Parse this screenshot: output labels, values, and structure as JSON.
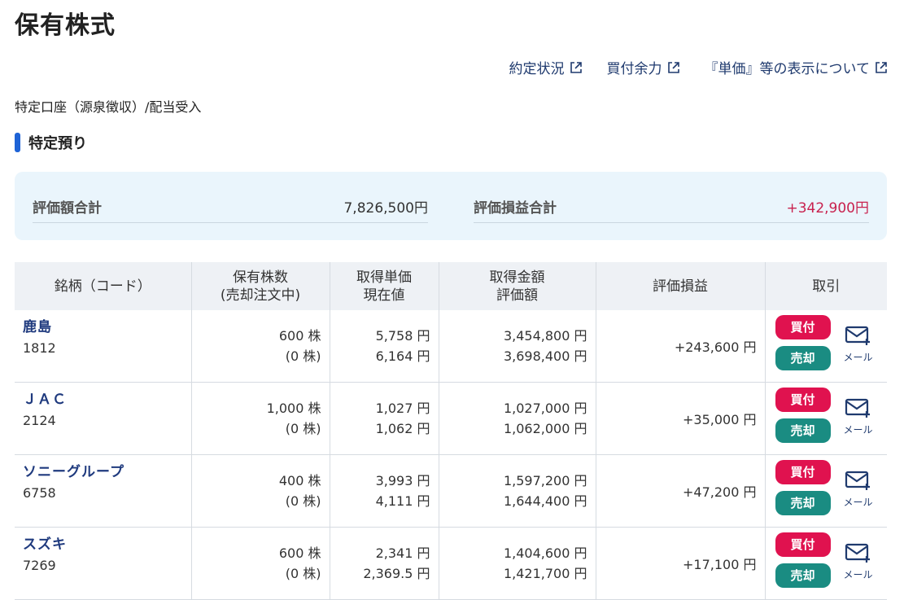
{
  "page_title": "保有株式",
  "links": [
    {
      "label": "約定状況"
    },
    {
      "label": "買付余力"
    },
    {
      "label": "『単価』等の表示について"
    }
  ],
  "account_type": "特定口座（源泉徴収）/配当受入",
  "section_title": "特定預り",
  "summary": {
    "valuation_label": "評価額合計",
    "valuation_value": "7,826,500円",
    "gain_label": "評価損益合計",
    "gain_value": "+342,900円"
  },
  "table": {
    "headers": {
      "name": "銘柄（コード）",
      "shares_1": "保有株数",
      "shares_2": "(売却注文中)",
      "price_1": "取得単価",
      "price_2": "現在値",
      "amount_1": "取得金額",
      "amount_2": "評価額",
      "gain": "評価損益",
      "trade": "取引"
    },
    "rows": [
      {
        "name": "鹿島",
        "code": "1812",
        "shares": "600 株",
        "selling": "(0 株)",
        "cost_price": "5,758 円",
        "current_price": "6,164 円",
        "cost_amount": "3,454,800 円",
        "valuation": "3,698,400 円",
        "gain": "+243,600 円"
      },
      {
        "name": "ＪＡＣ",
        "code": "2124",
        "shares": "1,000 株",
        "selling": "(0 株)",
        "cost_price": "1,027 円",
        "current_price": "1,062 円",
        "cost_amount": "1,027,000 円",
        "valuation": "1,062,000 円",
        "gain": "+35,000 円"
      },
      {
        "name": "ソニーグループ",
        "code": "6758",
        "shares": "400 株",
        "selling": "(0 株)",
        "cost_price": "3,993 円",
        "current_price": "4,111 円",
        "cost_amount": "1,597,200 円",
        "valuation": "1,644,400 円",
        "gain": "+47,200 円"
      },
      {
        "name": "スズキ",
        "code": "7269",
        "shares": "600 株",
        "selling": "(0 株)",
        "cost_price": "2,341 円",
        "current_price": "2,369.5 円",
        "cost_amount": "1,404,600 円",
        "valuation": "1,421,700 円",
        "gain": "+17,100 円"
      }
    ]
  },
  "buttons": {
    "buy": "買付",
    "sell": "売却",
    "mail": "メール"
  },
  "icons": {
    "external_link": "external-link-icon",
    "mail": "mail-plus-icon"
  },
  "colors": {
    "accent": "#1e63d6",
    "buy": "#e0124f",
    "sell": "#1a8c82",
    "gain": "#c8214e"
  }
}
